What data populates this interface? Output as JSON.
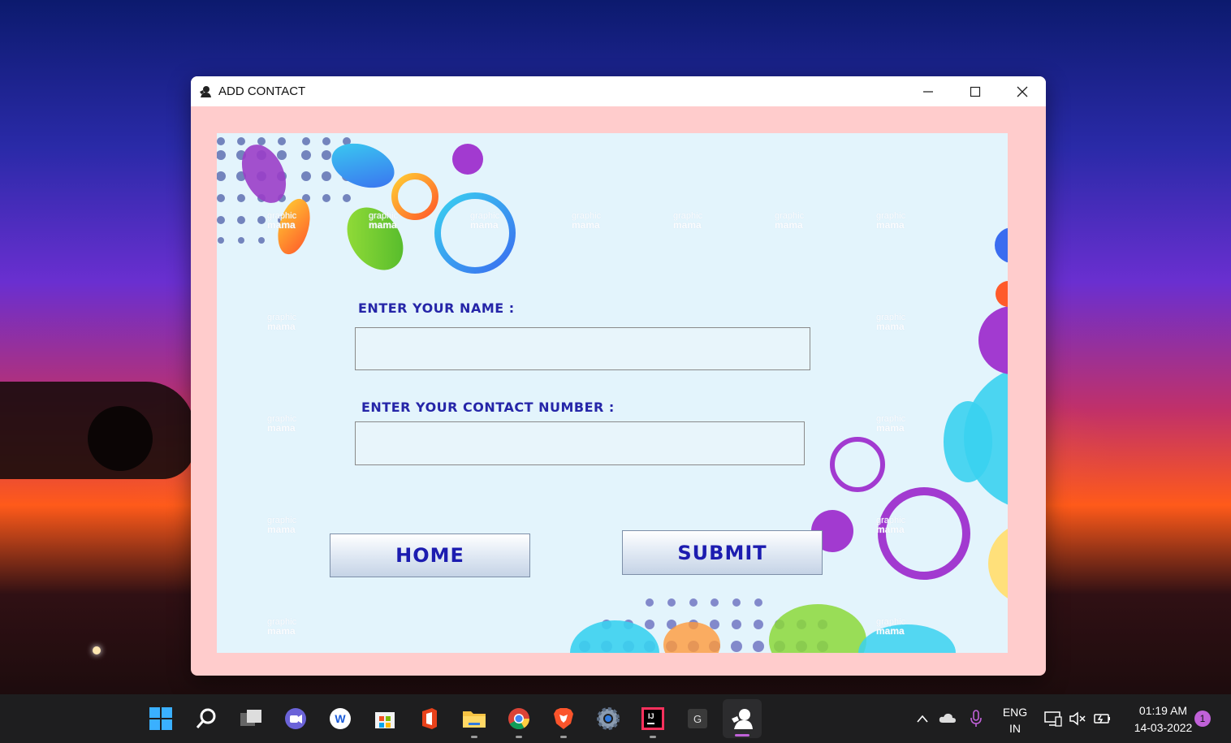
{
  "window": {
    "title": "ADD CONTACT",
    "controls": [
      "minimize-icon",
      "maximize-icon",
      "close-icon"
    ]
  },
  "form": {
    "name_label": "ENTER YOUR NAME :",
    "name_value": "",
    "contact_label": "ENTER YOUR CONTACT NUMBER :",
    "contact_value": "",
    "home_button": "HOME",
    "submit_button": "SUBMIT"
  },
  "watermark": {
    "line1": "graphic",
    "line2": "mama"
  },
  "taskbar": {
    "apps": [
      "start-icon",
      "search-icon",
      "task-view-icon",
      "chat-icon",
      "wps-icon",
      "store-icon",
      "office-icon",
      "file-explorer-icon",
      "chrome-icon",
      "brave-icon",
      "settings-icon",
      "intellij-icon",
      "g-app-icon",
      "add-contact-app-icon"
    ],
    "language_line1": "ENG",
    "language_line2": "IN",
    "time": "01:19 AM",
    "date": "14-03-2022",
    "notification_count": "1"
  },
  "colors": {
    "window_bg": "#ffcccc",
    "label_color": "#2525a8",
    "button_text": "#1c1cb0",
    "panel_bg": "#e3f4fc"
  }
}
